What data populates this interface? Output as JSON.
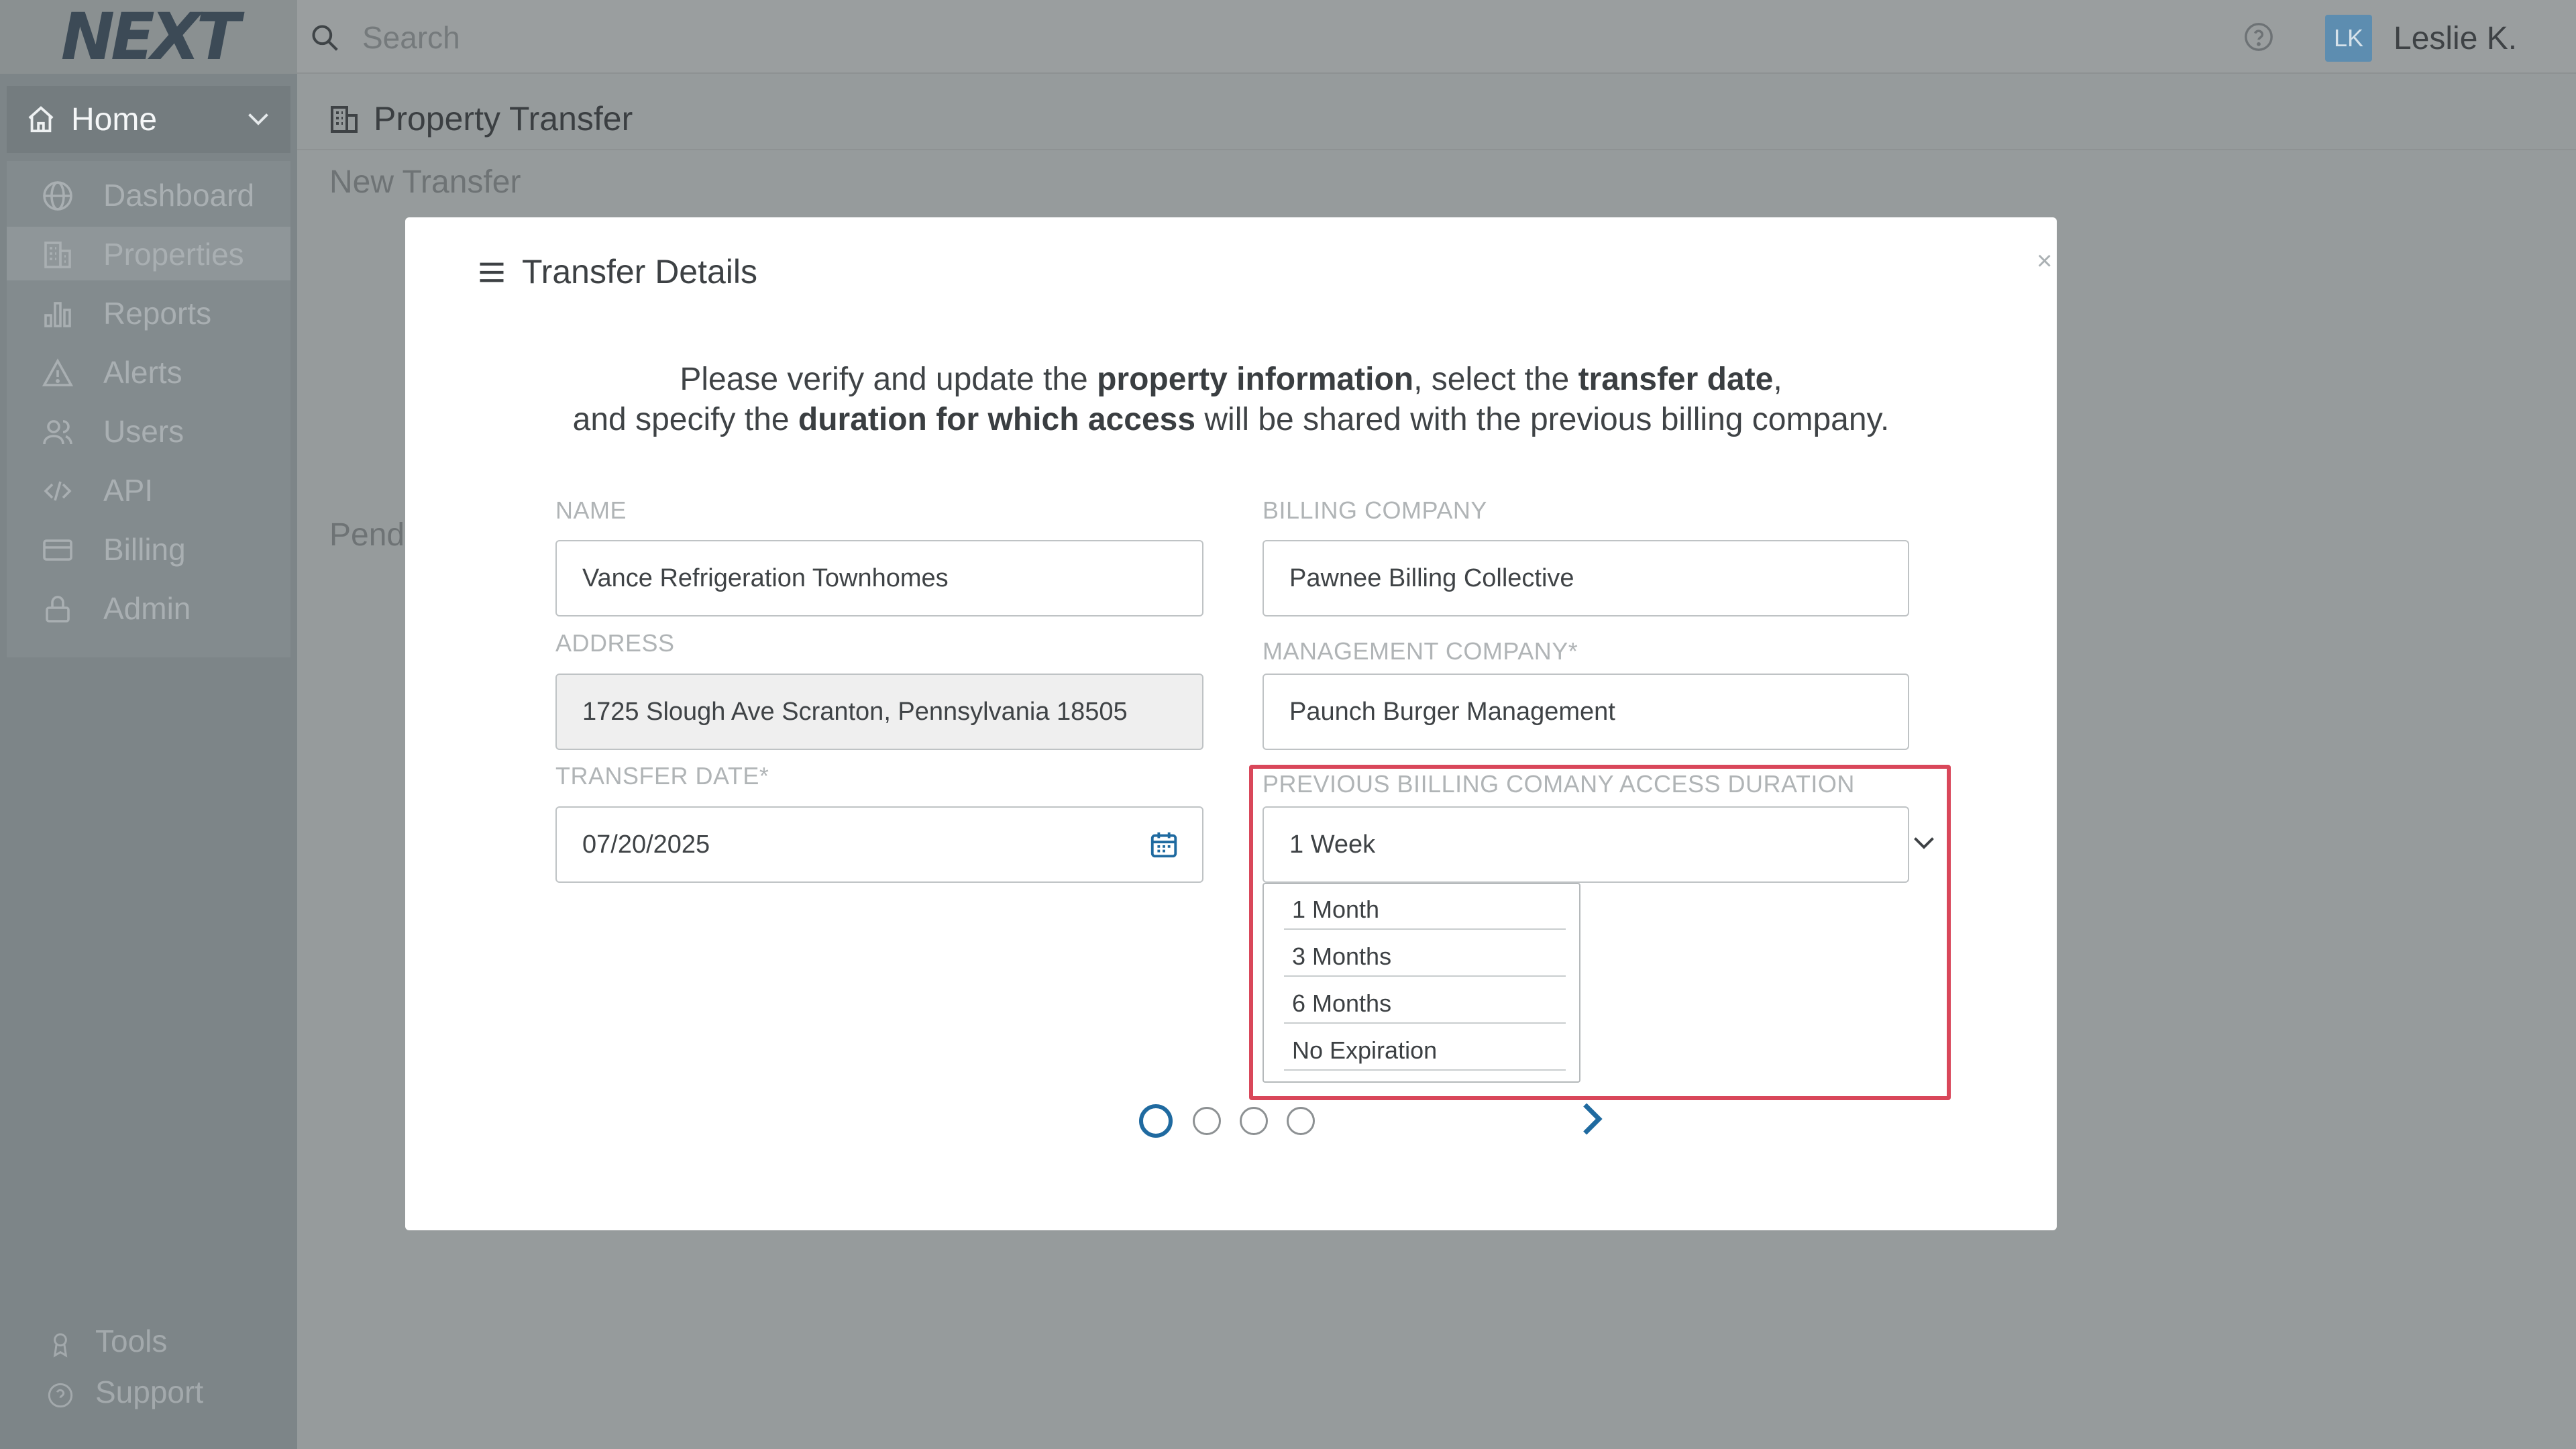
{
  "app": {
    "logo": "NEXT",
    "search_placeholder": "Search",
    "user_initials": "LK",
    "user_name": "Leslie K."
  },
  "sidebar": {
    "home_label": "Home",
    "items": [
      {
        "label": "Dashboard",
        "icon": "globe-icon"
      },
      {
        "label": "Properties",
        "icon": "building-icon",
        "active": true
      },
      {
        "label": "Reports",
        "icon": "bar-chart-icon"
      },
      {
        "label": "Alerts",
        "icon": "alert-triangle-icon"
      },
      {
        "label": "Users",
        "icon": "users-icon"
      },
      {
        "label": "API",
        "icon": "code-icon"
      },
      {
        "label": "Billing",
        "icon": "credit-card-icon"
      },
      {
        "label": "Admin",
        "icon": "lock-icon"
      }
    ],
    "bottom": [
      {
        "label": "Tools",
        "icon": "award-icon"
      },
      {
        "label": "Support",
        "icon": "help-icon"
      }
    ]
  },
  "page": {
    "title": "Property Transfer",
    "new_transfer": "New Transfer",
    "pending": "Pendi"
  },
  "modal": {
    "title": "Transfer Details",
    "intro_1a": "Please verify and update the ",
    "intro_1b": "property information",
    "intro_1c": ", select the ",
    "intro_1d": "transfer date",
    "intro_1e": ",",
    "intro_2a": "and specify the ",
    "intro_2b": "duration for which access",
    "intro_2c": " will be shared with the previous billing company.",
    "name_label": "NAME",
    "name_value": "Vance Refrigeration Townhomes",
    "address_label": "ADDRESS",
    "address_value": "1725 Slough Ave Scranton, Pennsylvania 18505",
    "transfer_date_label": "TRANSFER DATE*",
    "transfer_date_value": "07/20/2025",
    "billing_company_label": "BILLING COMPANY",
    "billing_company_value": "Pawnee Billing Collective",
    "management_company_label": "MANAGEMENT COMPANY*",
    "management_company_value": "Paunch Burger Management",
    "access_duration_label": "PREVIOUS BIILLING COMANY  ACCESS DURATION",
    "access_duration_value": "1 Week",
    "access_duration_options": [
      "1 Month",
      "3 Months",
      "6 Months",
      "No Expiration"
    ],
    "steps_total": 4,
    "current_step": 1
  },
  "colors": {
    "accent": "#1f6aa0",
    "highlight": "#d9475a",
    "overlay": "#969b9c"
  }
}
